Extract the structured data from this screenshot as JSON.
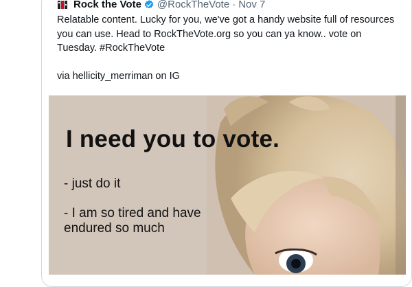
{
  "tweet": {
    "author_name": "Rock the Vote",
    "handle": "@RockTheVote",
    "separator": "·",
    "date": "Nov 7",
    "text": "Relatable content. Lucky for you, we've got a handy website full of resources you can use. Head to RockTheVote.org so you can ya know.. vote on Tuesday. #RockTheVote",
    "via": "via hellicity_merriman on IG"
  },
  "media": {
    "title": "I need you to vote.",
    "line1": "- just do it",
    "line2": "- I am so tired and have endured so much"
  },
  "icons": {
    "avatar": "rock-the-vote-logo-icon",
    "verified": "verified-badge-icon"
  },
  "colors": {
    "verified_blue": "#1d9bf0",
    "secondary_text": "#536471",
    "primary_text": "#0f1419",
    "border": "#cfd9de"
  }
}
